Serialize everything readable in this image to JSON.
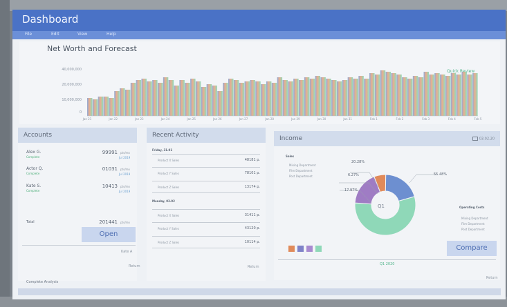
{
  "header": {
    "title": "Dashboard",
    "menu": [
      "File",
      "Edit",
      "View",
      "Help"
    ]
  },
  "networth": {
    "title": "Net Worth and Forecast",
    "link": "Quick Review",
    "yticks": [
      "40,000,000",
      "20,000,000",
      "10,000,000",
      "0"
    ],
    "xticks": [
      "Jan 21",
      "Jan 22",
      "Jan 23",
      "Jan 24",
      "Jan 25",
      "Jan 26",
      "Jan 27",
      "Jan 28",
      "Jan 29",
      "Jan 30",
      "Jan 31",
      "Feb 1",
      "Feb 2",
      "Feb 3",
      "Feb 4",
      "Feb 5"
    ],
    "values": [
      13,
      12,
      14,
      14,
      13,
      18,
      20,
      19,
      24,
      26,
      27,
      25,
      26,
      24,
      28,
      26,
      22,
      26,
      24,
      27,
      25,
      21,
      23,
      22,
      18,
      24,
      27,
      26,
      24,
      25,
      26,
      25,
      23,
      25,
      24,
      28,
      26,
      25,
      27,
      26,
      28,
      27,
      29,
      28,
      27,
      26,
      25,
      26,
      28,
      27,
      29,
      27,
      31,
      30,
      33,
      32,
      31,
      30,
      28,
      27,
      29,
      28,
      32,
      30,
      31,
      30,
      29,
      31,
      30,
      32,
      30,
      31
    ],
    "colors": {
      "start": "#7f9cd0",
      "mid": "#e8a27a",
      "end": "#7fd6b0"
    }
  },
  "accounts": {
    "title": "Accounts",
    "rows": [
      {
        "name": "Alex G.",
        "status": "Complete",
        "amount": "99991",
        "unit": "pts/mo",
        "date": "Jul 2019"
      },
      {
        "name": "Actor Q.",
        "status": "Complete",
        "amount": "01031",
        "unit": "pts/mo",
        "date": "Jul 2019"
      },
      {
        "name": "Kate S.",
        "status": "Complete",
        "amount": "10413",
        "unit": "pts/mo",
        "date": "Jul 2019"
      }
    ],
    "total_label": "Total",
    "total_amount": "201441",
    "total_unit": "pts/mo",
    "button": "Open",
    "footer_link": "Kate A",
    "return_link": "Return"
  },
  "activity": {
    "title": "Recent Activity",
    "group1": "Friday, 31.01",
    "group2": "Monday, 03.02",
    "items1": [
      {
        "label": "Product X Sales",
        "value": "48181 p."
      },
      {
        "label": "Product Y Sales",
        "value": "78101 p."
      },
      {
        "label": "Product Z Sales",
        "value": "13174 p."
      }
    ],
    "items2": [
      {
        "label": "Product X Sales",
        "value": "31411 p."
      },
      {
        "label": "Product Y Sales",
        "value": "43120 p."
      },
      {
        "label": "Product Z Sales",
        "value": "10114 p."
      }
    ],
    "return_link": "Return"
  },
  "income": {
    "title": "Income",
    "date_link": "03.02.20",
    "left_legend_title": "Sales",
    "left_legend": [
      "Mixing Department",
      "Film Department",
      "Post Department"
    ],
    "right_legend_title": "Operating Costs",
    "right_legend": [
      "Mixing Department",
      "Film Department",
      "Post Department"
    ],
    "center_label": "Q1",
    "slices": [
      {
        "label": "6.27%",
        "value": 6.27,
        "color": "#e08a5a"
      },
      {
        "label": "20.28%",
        "value": 20.28,
        "color": "#6d8fd0"
      },
      {
        "label": "55.48%",
        "value": 55.48,
        "color": "#8fd8b8"
      },
      {
        "label": "17.97%",
        "value": 17.97,
        "color": "#9f7cc4"
      }
    ],
    "swatches": [
      "#e08a5a",
      "#7f82c8",
      "#a88ad0",
      "#8fd8b8"
    ],
    "bottom_link": "Q1 2020",
    "button": "Compare",
    "return_link": "Return"
  },
  "footer": {
    "text": "Complete Analysis"
  }
}
